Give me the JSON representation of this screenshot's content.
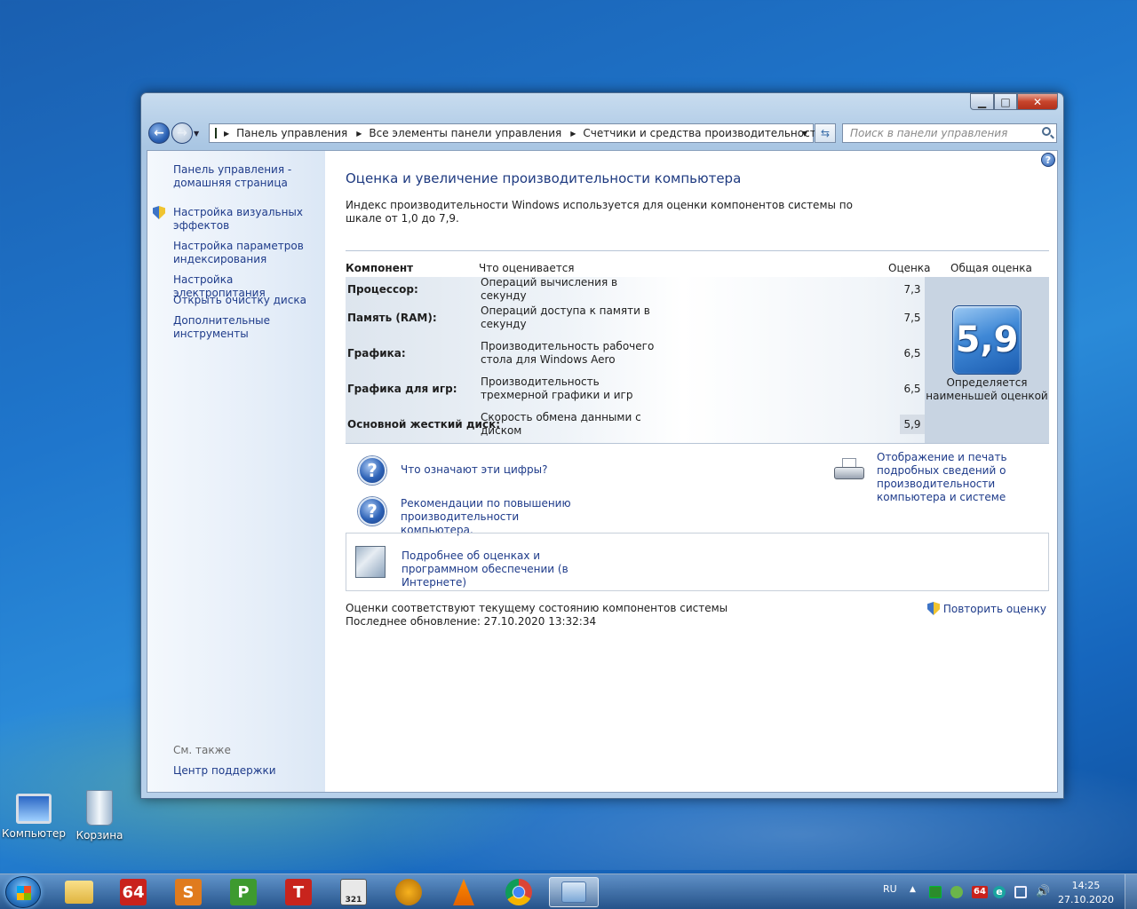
{
  "desktop": {
    "icons": [
      {
        "label": "Компьютер"
      },
      {
        "label": "Корзина"
      }
    ]
  },
  "window": {
    "address": {
      "crumbs": [
        "Панель управления",
        "Все элементы панели управления",
        "Счетчики и средства производительности"
      ]
    },
    "search_placeholder": "Поиск в панели управления",
    "sidebar": {
      "items": [
        {
          "label": "Панель управления - домашняя страница",
          "shield": false
        },
        {
          "label": "Настройка визуальных эффектов",
          "shield": true
        },
        {
          "label": "Настройка параметров индексирования",
          "shield": false
        },
        {
          "label": "Настройка электропитания",
          "shield": false
        },
        {
          "label": "Открыть очистку диска",
          "shield": false
        },
        {
          "label": "Дополнительные инструменты",
          "shield": false
        }
      ],
      "see_also": "См. также",
      "support_link": "Центр поддержки"
    },
    "main": {
      "title": "Оценка и увеличение производительности компьютера",
      "intro": "Индекс производительности Windows используется для оценки компонентов системы по шкале от 1,0 до 7,9.",
      "table": {
        "headers": {
          "component": "Компонент",
          "what": "Что оценивается",
          "score": "Оценка",
          "overall": "Общая оценка"
        },
        "rows": [
          {
            "component": "Процессор:",
            "what": "Операций вычисления в секунду",
            "score": "7,3"
          },
          {
            "component": "Память (RAM):",
            "what": "Операций доступа к памяти в секунду",
            "score": "7,5"
          },
          {
            "component": "Графика:",
            "what": "Производительность рабочего стола для Windows Aero",
            "score": "6,5"
          },
          {
            "component": "Графика для игр:",
            "what": "Производительность трехмерной графики и игр",
            "score": "6,5"
          },
          {
            "component": "Основной жесткий диск:",
            "what": "Скорость обмена данными с диском",
            "score": "5,9"
          }
        ],
        "overall_score": "5,9",
        "overall_caption": "Определяется наименьшей оценкой"
      },
      "links": {
        "what_numbers": "Что означают эти цифры?",
        "tips": "Рекомендации по повышению производительности компьютера.",
        "print": "Отображение и печать подробных сведений о производительности компьютера и системе",
        "online": "Подробнее об оценках и программном обеспечении (в Интернете)",
        "rerun": "Повторить оценку"
      },
      "status_line1": "Оценки соответствуют текущему состоянию компонентов системы",
      "status_line2": "Последнее обновление: 27.10.2020 13:32:34"
    }
  },
  "taskbar": {
    "apps": [
      {
        "name": "explorer",
        "label": ""
      },
      {
        "name": "aida64",
        "label": "64"
      },
      {
        "name": "app-s",
        "label": "S"
      },
      {
        "name": "app-p",
        "label": "P"
      },
      {
        "name": "app-t",
        "label": "T"
      },
      {
        "name": "media-321",
        "label": "321"
      },
      {
        "name": "aimp",
        "label": ""
      },
      {
        "name": "vlc",
        "label": ""
      },
      {
        "name": "chrome",
        "label": ""
      },
      {
        "name": "perf-window",
        "label": ""
      }
    ],
    "lang": "RU",
    "tray64": "64",
    "tray_e": "e",
    "time": "14:25",
    "date": "27.10.2020"
  }
}
